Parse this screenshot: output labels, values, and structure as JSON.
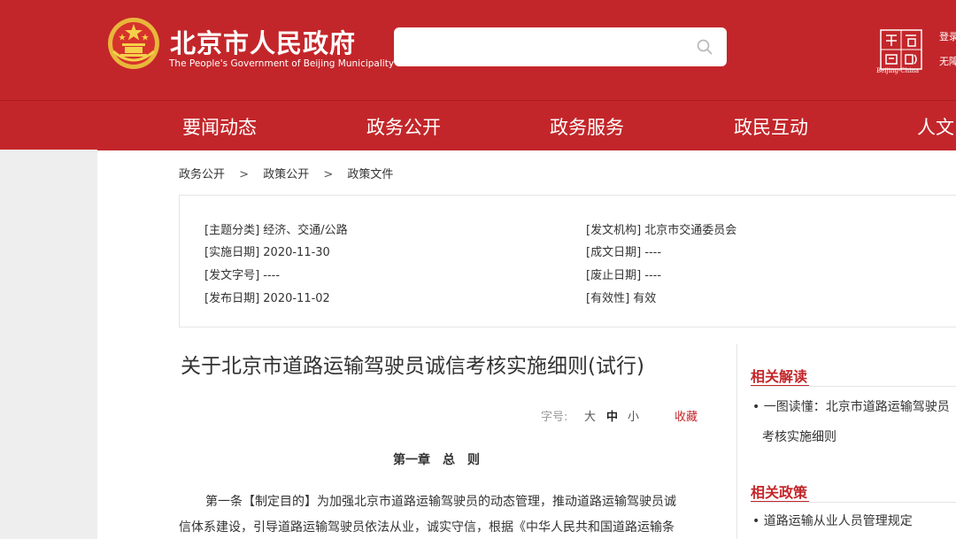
{
  "header": {
    "site_title": "北京市人民政府",
    "site_subtitle": "The People's Government of Beijing Municipality",
    "search_placeholder": "",
    "capital_logo_text": "Beijing-China",
    "login_label": "登录",
    "accessibility_label": "无障",
    "brand_color": "#c3262a"
  },
  "nav": {
    "items": [
      {
        "label": "要闻动态"
      },
      {
        "label": "政务公开"
      },
      {
        "label": "政务服务"
      },
      {
        "label": "政民互动"
      },
      {
        "label": "人文"
      }
    ]
  },
  "breadcrumb": {
    "items": [
      "政务公开",
      "政策公开",
      "政策文件"
    ],
    "separator": ">"
  },
  "meta": {
    "left": [
      {
        "text": "[主题分类] 经济、交通/公路"
      },
      {
        "text": "[实施日期] 2020-11-30"
      },
      {
        "text": "[发文字号] ----"
      },
      {
        "text": "[发布日期] 2020-11-02"
      }
    ],
    "right": [
      {
        "text": "[发文机构] 北京市交通委员会"
      },
      {
        "text": "[成文日期] ----"
      },
      {
        "text": "[废止日期] ----"
      },
      {
        "text": "[有效性] 有效"
      }
    ]
  },
  "article": {
    "title": "关于北京市道路运输驾驶员诚信考核实施细则(试行)",
    "font_size_label": "字号:",
    "font_sizes": [
      "大",
      "中",
      "小"
    ],
    "favorite_label": "收藏",
    "chapter_title": "第一章　总　则",
    "para1_line1": "第一条【制定目的】为加强北京市道路运输驾驶员的动态管理，推动道路运输驾驶员诚",
    "para1_line2": "信体系建设，引导道路运输驾驶员依法从业，诚实守信，根据《中华人民共和国道路运输条"
  },
  "sidebar": {
    "related_reading": {
      "heading": "相关解读",
      "item_line1": "• 一图读懂：北京市道路运输驾驶员",
      "item_line2": "考核实施细则"
    },
    "related_policy": {
      "heading": "相关政策",
      "item": "• 道路运输从业人员管理规定"
    }
  }
}
